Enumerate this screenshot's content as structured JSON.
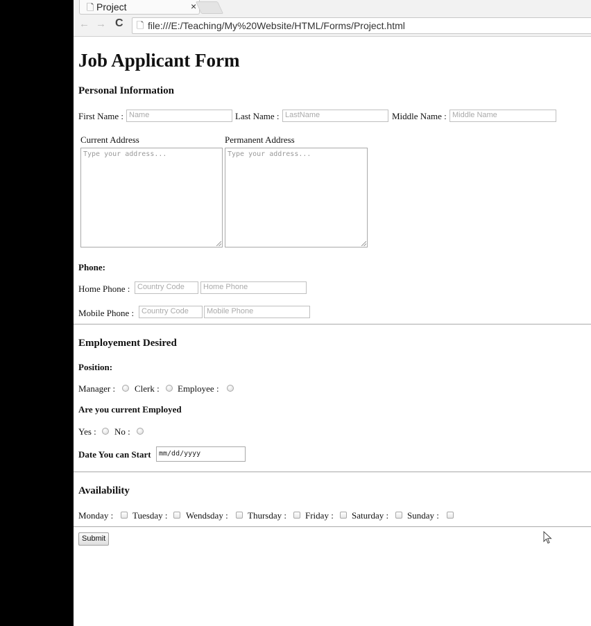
{
  "browser": {
    "tab_title": "Project",
    "tab_close": "×",
    "url": "file:///E:/Teaching/My%20Website/HTML/Forms/Project.html",
    "back": "←",
    "forward": "→",
    "reload": "C"
  },
  "form": {
    "title": "Job Applicant Form",
    "personal": {
      "heading": "Personal Information",
      "first_name_label": "First Name :",
      "first_name_placeholder": "Name",
      "last_name_label": "Last Name :",
      "last_name_placeholder": "LastName",
      "middle_name_label": "Middle Name :",
      "middle_name_placeholder": "Middle Name",
      "current_address_label": "Current Address",
      "permanent_address_label": "Permanent Address",
      "address_placeholder": "Type your address..."
    },
    "phone": {
      "heading": "Phone:",
      "home_label": "Home Phone :",
      "mobile_label": "Mobile Phone :",
      "country_code_placeholder": "Country Code",
      "home_phone_placeholder": "Home Phone",
      "mobile_phone_placeholder": "Mobile Phone"
    },
    "employment": {
      "heading": "Employement Desired",
      "position_heading": "Position:",
      "positions": [
        "Manager :",
        "Clerk :",
        "Employee :"
      ],
      "employed_heading": "Are you current Employed",
      "employed_options": [
        "Yes :",
        "No :"
      ],
      "start_label": "Date You can Start",
      "date_placeholder": "mm/dd/yyyy"
    },
    "availability": {
      "heading": "Availability",
      "days": [
        "Monday :",
        "Tuesday :",
        "Wendsday :",
        "Thursday :",
        "Friday :",
        "Saturday :",
        "Sunday :"
      ]
    },
    "submit_label": "Submit"
  }
}
